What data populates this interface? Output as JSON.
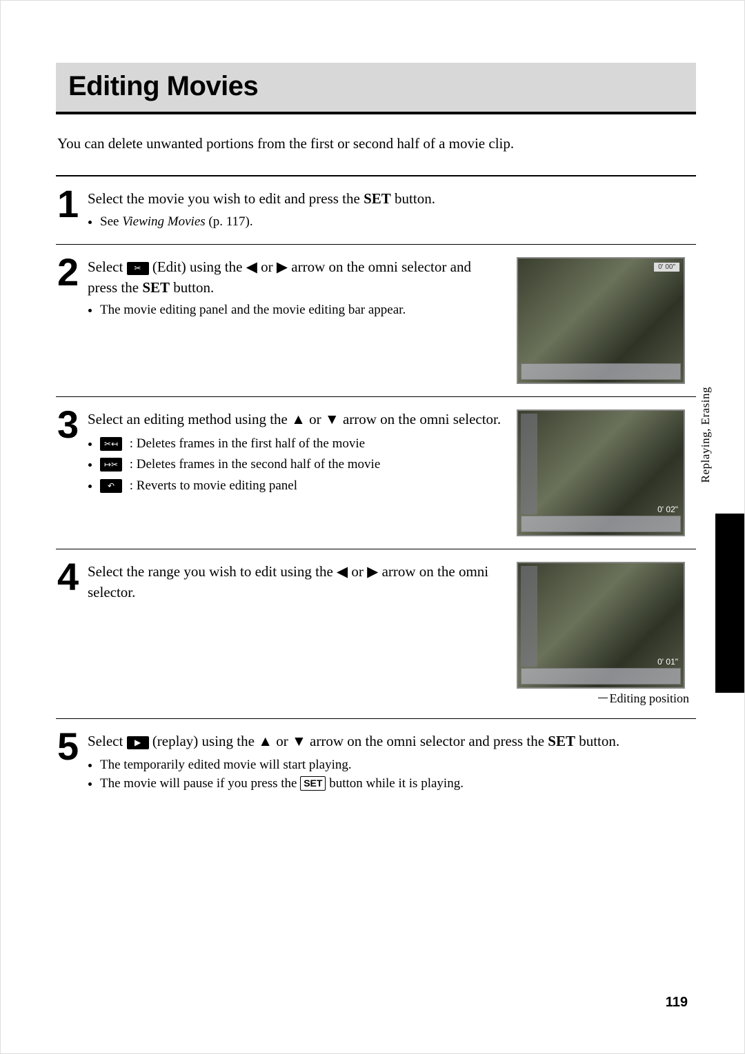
{
  "title": "Editing Movies",
  "intro": "You can delete unwanted portions from the first or second half of a movie clip.",
  "side_label": "Replaying, Erasing",
  "page_number": "119",
  "steps": {
    "s1": {
      "num": "1",
      "head_a": "Select the movie you wish to edit and press the ",
      "head_set": "SET",
      "head_b": " button.",
      "bullet": "See ",
      "bullet_ital": "Viewing Movies",
      "bullet_ref": " (p. 117)."
    },
    "s2": {
      "num": "2",
      "head_a": "Select ",
      "icon": "✂",
      "head_b": " (Edit) using the ",
      "tri_l": "◀",
      "or": " or ",
      "tri_r": "▶",
      "head_c": " arrow on the omni selector and press the ",
      "head_set": "SET",
      "head_d": " button.",
      "bullet": "The movie editing panel and the movie editing bar appear.",
      "shot_top": "0' 00\""
    },
    "s3": {
      "num": "3",
      "head_a": "Select an editing method using the ",
      "tri_u": "▲",
      "or": " or ",
      "tri_d": "▼",
      "head_b": " arrow on the omni selector.",
      "def1_icon": "✂↤",
      "def1_text": ": Deletes frames in the first half of the movie",
      "def2_icon": "↦✂",
      "def2_text": ": Deletes frames in the second half of the movie",
      "def3_icon": "↶",
      "def3_text": ": Reverts to movie editing panel",
      "shot_time": "0' 02\""
    },
    "s4": {
      "num": "4",
      "head_a": "Select the range you wish to edit using the ",
      "tri_l": "◀",
      "or": " or ",
      "tri_r": "▶",
      "head_b": " arrow on the omni selector.",
      "shot_time": "0' 01\"",
      "caption": "Editing position"
    },
    "s5": {
      "num": "5",
      "head_a": "Select ",
      "icon": "▶",
      "head_b": " (replay) using the ",
      "tri_u": "▲",
      "or": " or ",
      "tri_d": "▼",
      "head_c": " arrow on the omni selector and press the ",
      "head_set": "SET",
      "head_d": " button.",
      "bullet1": "The temporarily edited movie will start playing.",
      "bullet2_a": "The movie will pause if you press the ",
      "bullet2_set": "SET",
      "bullet2_b": " button while it is playing."
    }
  }
}
